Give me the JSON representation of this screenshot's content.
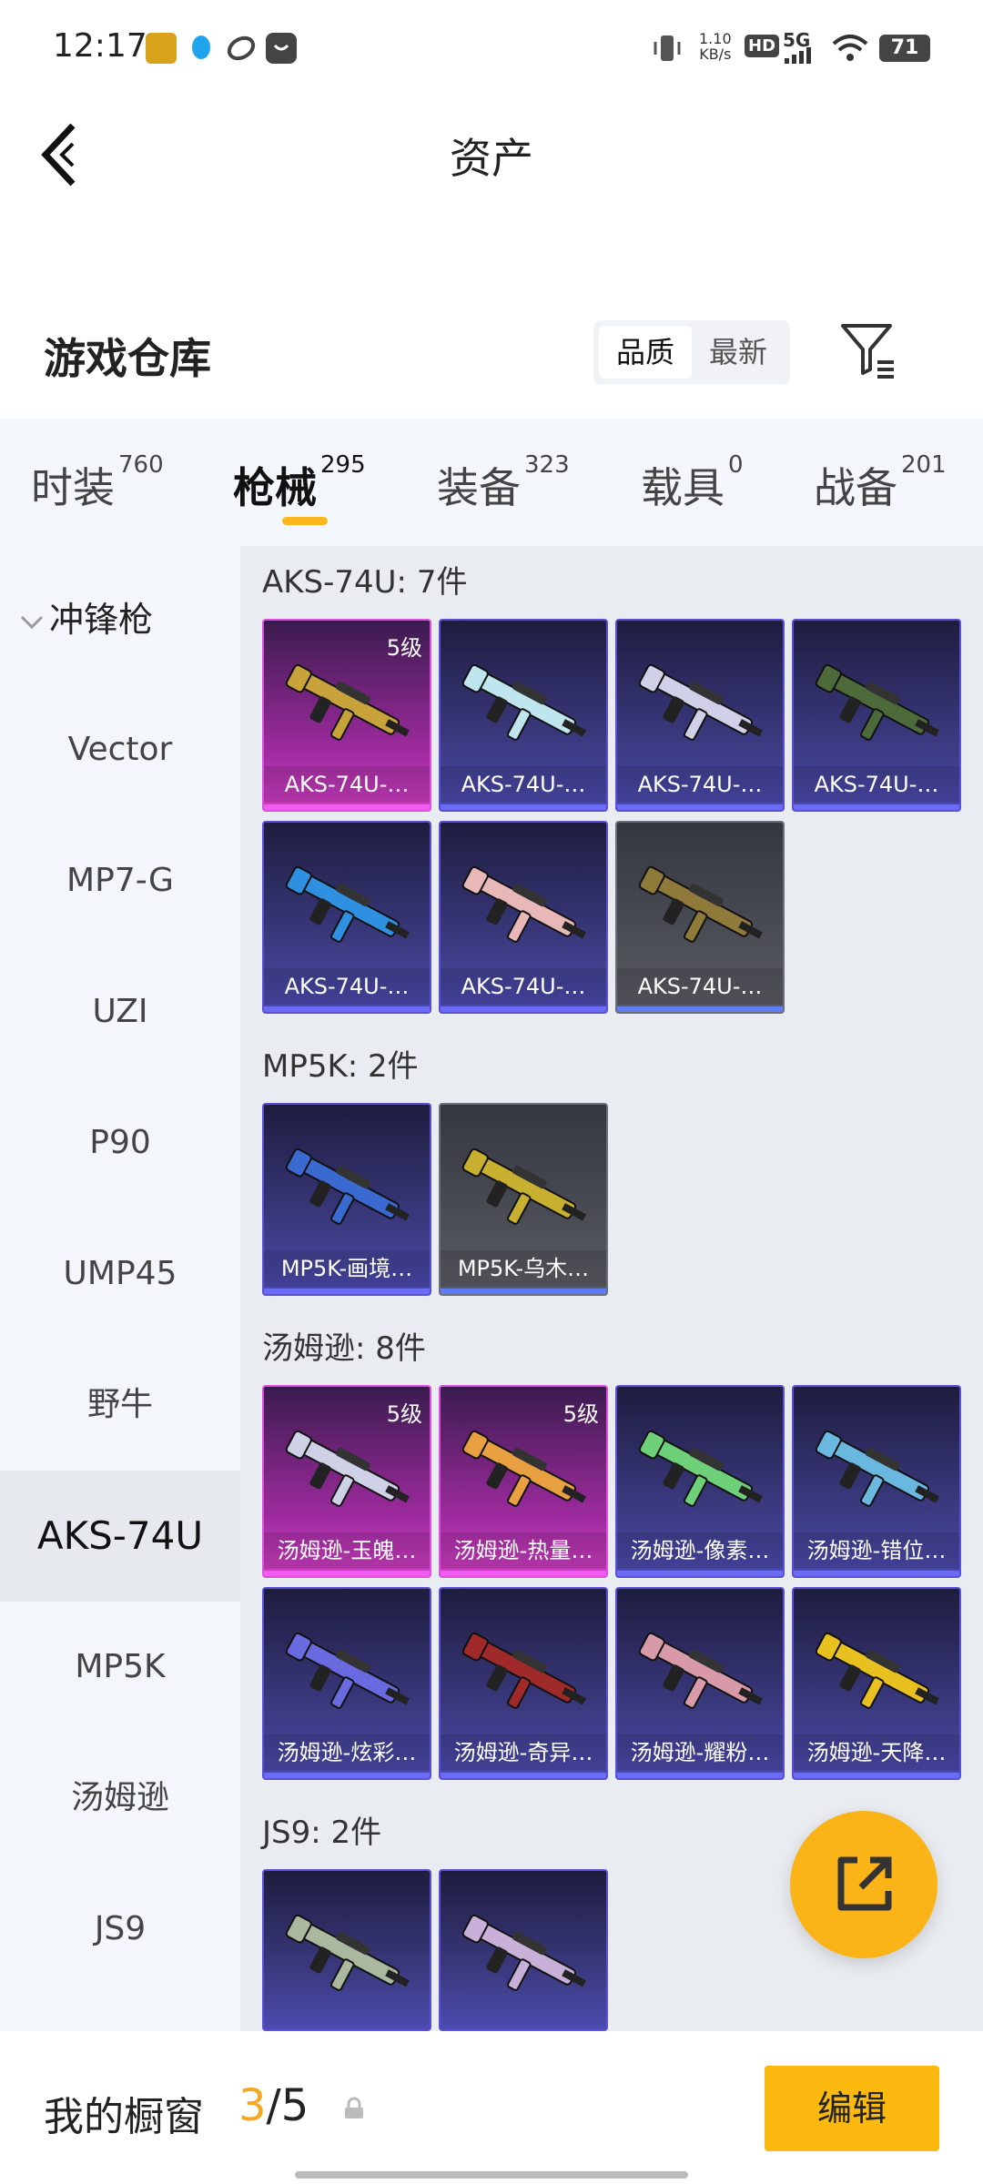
{
  "status_bar": {
    "time": "12:17",
    "net_speed": "1.10",
    "net_unit": "KB/s",
    "hd": "HD",
    "signal": "5G",
    "battery": "71"
  },
  "header": {
    "title": "资产"
  },
  "warehouse": {
    "title": "游戏仓库",
    "sort_options": [
      "品质",
      "最新"
    ],
    "active_sort": "品质"
  },
  "tabs": [
    {
      "label": "时装",
      "count": "760",
      "active": false
    },
    {
      "label": "枪械",
      "count": "295",
      "active": true
    },
    {
      "label": "装备",
      "count": "323",
      "active": false
    },
    {
      "label": "载具",
      "count": "0",
      "active": false
    },
    {
      "label": "战备",
      "count": "201",
      "active": false
    }
  ],
  "sidebar": {
    "group_label": "冲锋枪",
    "items": [
      {
        "label": "Vector"
      },
      {
        "label": "MP7-G"
      },
      {
        "label": "UZI"
      },
      {
        "label": "P90"
      },
      {
        "label": "UMP45"
      },
      {
        "label": "野牛"
      },
      {
        "label": "AKS-74U",
        "active": true
      },
      {
        "label": "MP5K"
      },
      {
        "label": "汤姆逊"
      },
      {
        "label": "JS9"
      }
    ]
  },
  "sections": [
    {
      "title": "AKS-74U: 7件",
      "items": [
        {
          "name": "AKS-74U-…",
          "rarity": "pink",
          "level": "5级",
          "gun_color": "#c8a23a"
        },
        {
          "name": "AKS-74U-…",
          "rarity": "blue",
          "level": "",
          "gun_color": "#bfe6ef"
        },
        {
          "name": "AKS-74U-…",
          "rarity": "blue",
          "level": "",
          "gun_color": "#d0d0e8"
        },
        {
          "name": "AKS-74U-…",
          "rarity": "blue",
          "level": "",
          "gun_color": "#4d6b3a"
        },
        {
          "name": "AKS-74U-…",
          "rarity": "blue",
          "level": "",
          "gun_color": "#2f8fe0"
        },
        {
          "name": "AKS-74U-…",
          "rarity": "blue",
          "level": "",
          "gun_color": "#e8b8b8"
        },
        {
          "name": "AKS-74U-…",
          "rarity": "gray",
          "level": "",
          "gun_color": "#8f7a3a"
        }
      ]
    },
    {
      "title": "MP5K: 2件",
      "items": [
        {
          "name": "MP5K-画境…",
          "rarity": "blue",
          "level": "",
          "gun_color": "#3a6ad0"
        },
        {
          "name": "MP5K-乌木…",
          "rarity": "gray",
          "level": "",
          "gun_color": "#c8b030"
        }
      ]
    },
    {
      "title": "汤姆逊: 8件",
      "items": [
        {
          "name": "汤姆逊-玉魄…",
          "rarity": "pink",
          "level": "5级",
          "gun_color": "#cfd2e6"
        },
        {
          "name": "汤姆逊-热量…",
          "rarity": "pink",
          "level": "5级",
          "gun_color": "#e8a040"
        },
        {
          "name": "汤姆逊-像素…",
          "rarity": "blue",
          "level": "",
          "gun_color": "#6fd07a"
        },
        {
          "name": "汤姆逊-错位…",
          "rarity": "blue",
          "level": "",
          "gun_color": "#6ab7e0"
        },
        {
          "name": "汤姆逊-炫彩…",
          "rarity": "blue",
          "level": "",
          "gun_color": "#6a6ae0"
        },
        {
          "name": "汤姆逊-奇异…",
          "rarity": "blue",
          "level": "",
          "gun_color": "#a02a2a"
        },
        {
          "name": "汤姆逊-耀粉…",
          "rarity": "blue",
          "level": "",
          "gun_color": "#d89aa8"
        },
        {
          "name": "汤姆逊-天降…",
          "rarity": "blue",
          "level": "",
          "gun_color": "#e8c020"
        }
      ]
    },
    {
      "title": "JS9: 2件",
      "items": [
        {
          "name": "",
          "rarity": "blue",
          "level": "",
          "gun_color": "#aab8a0"
        },
        {
          "name": "",
          "rarity": "blue",
          "level": "",
          "gun_color": "#c8b0d8"
        }
      ]
    }
  ],
  "showcase": {
    "title": "我的橱窗",
    "current": "3",
    "separator": "/",
    "max": "5",
    "edit_label": "编辑"
  },
  "icons": {
    "back": "back-arrow-icon",
    "filter": "filter-icon",
    "share": "share-out-icon",
    "lock": "lock-icon"
  },
  "colors": {
    "accent": "#fbb90f",
    "count_highlight": "#f5a623"
  }
}
